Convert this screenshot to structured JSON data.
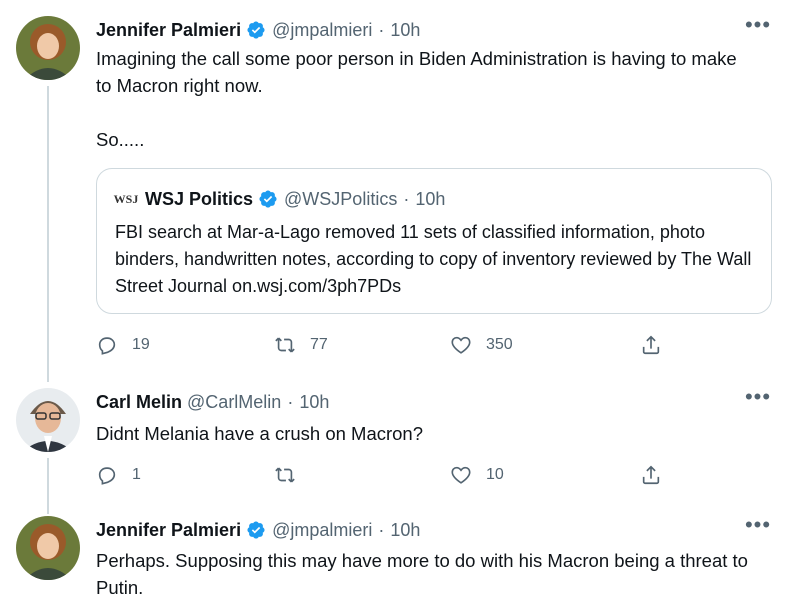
{
  "tweets": [
    {
      "name": "Jennifer Palmieri",
      "handle": "@jmpalmieri",
      "separator": "·",
      "time": "10h",
      "verified": true,
      "text_lines": [
        "Imagining the call some poor person in Biden Administration is having to make to Macron right now.",
        "So....."
      ],
      "quote": {
        "name": "WSJ Politics",
        "handle": "@WSJPolitics",
        "separator": "·",
        "time": "10h",
        "logo": "WSJ",
        "text": "FBI search at Mar-a-Lago removed 11 sets of classified information, photo binders, handwritten notes, according to copy of inventory reviewed by The Wall Street Journal on.wsj.com/3ph7PDs"
      },
      "actions": {
        "replies": "19",
        "retweets": "77",
        "likes": "350"
      }
    },
    {
      "name": "Carl Melin",
      "handle": "@CarlMelin",
      "separator": "·",
      "time": "10h",
      "verified": false,
      "text_lines": [
        "Didnt Melania have a crush on Macron?"
      ],
      "actions": {
        "replies": "1",
        "retweets": "",
        "likes": "10"
      }
    },
    {
      "name": "Jennifer Palmieri",
      "handle": "@jmpalmieri",
      "separator": "·",
      "time": "10h",
      "verified": true,
      "text_lines": [
        "Perhaps.  Supposing this may have more to do with his Macron being a threat to Putin."
      ]
    }
  ],
  "more_label": "•••",
  "colors": {
    "verified": "#1d9bf0",
    "secondary": "#536471",
    "border": "#cfd9de"
  }
}
